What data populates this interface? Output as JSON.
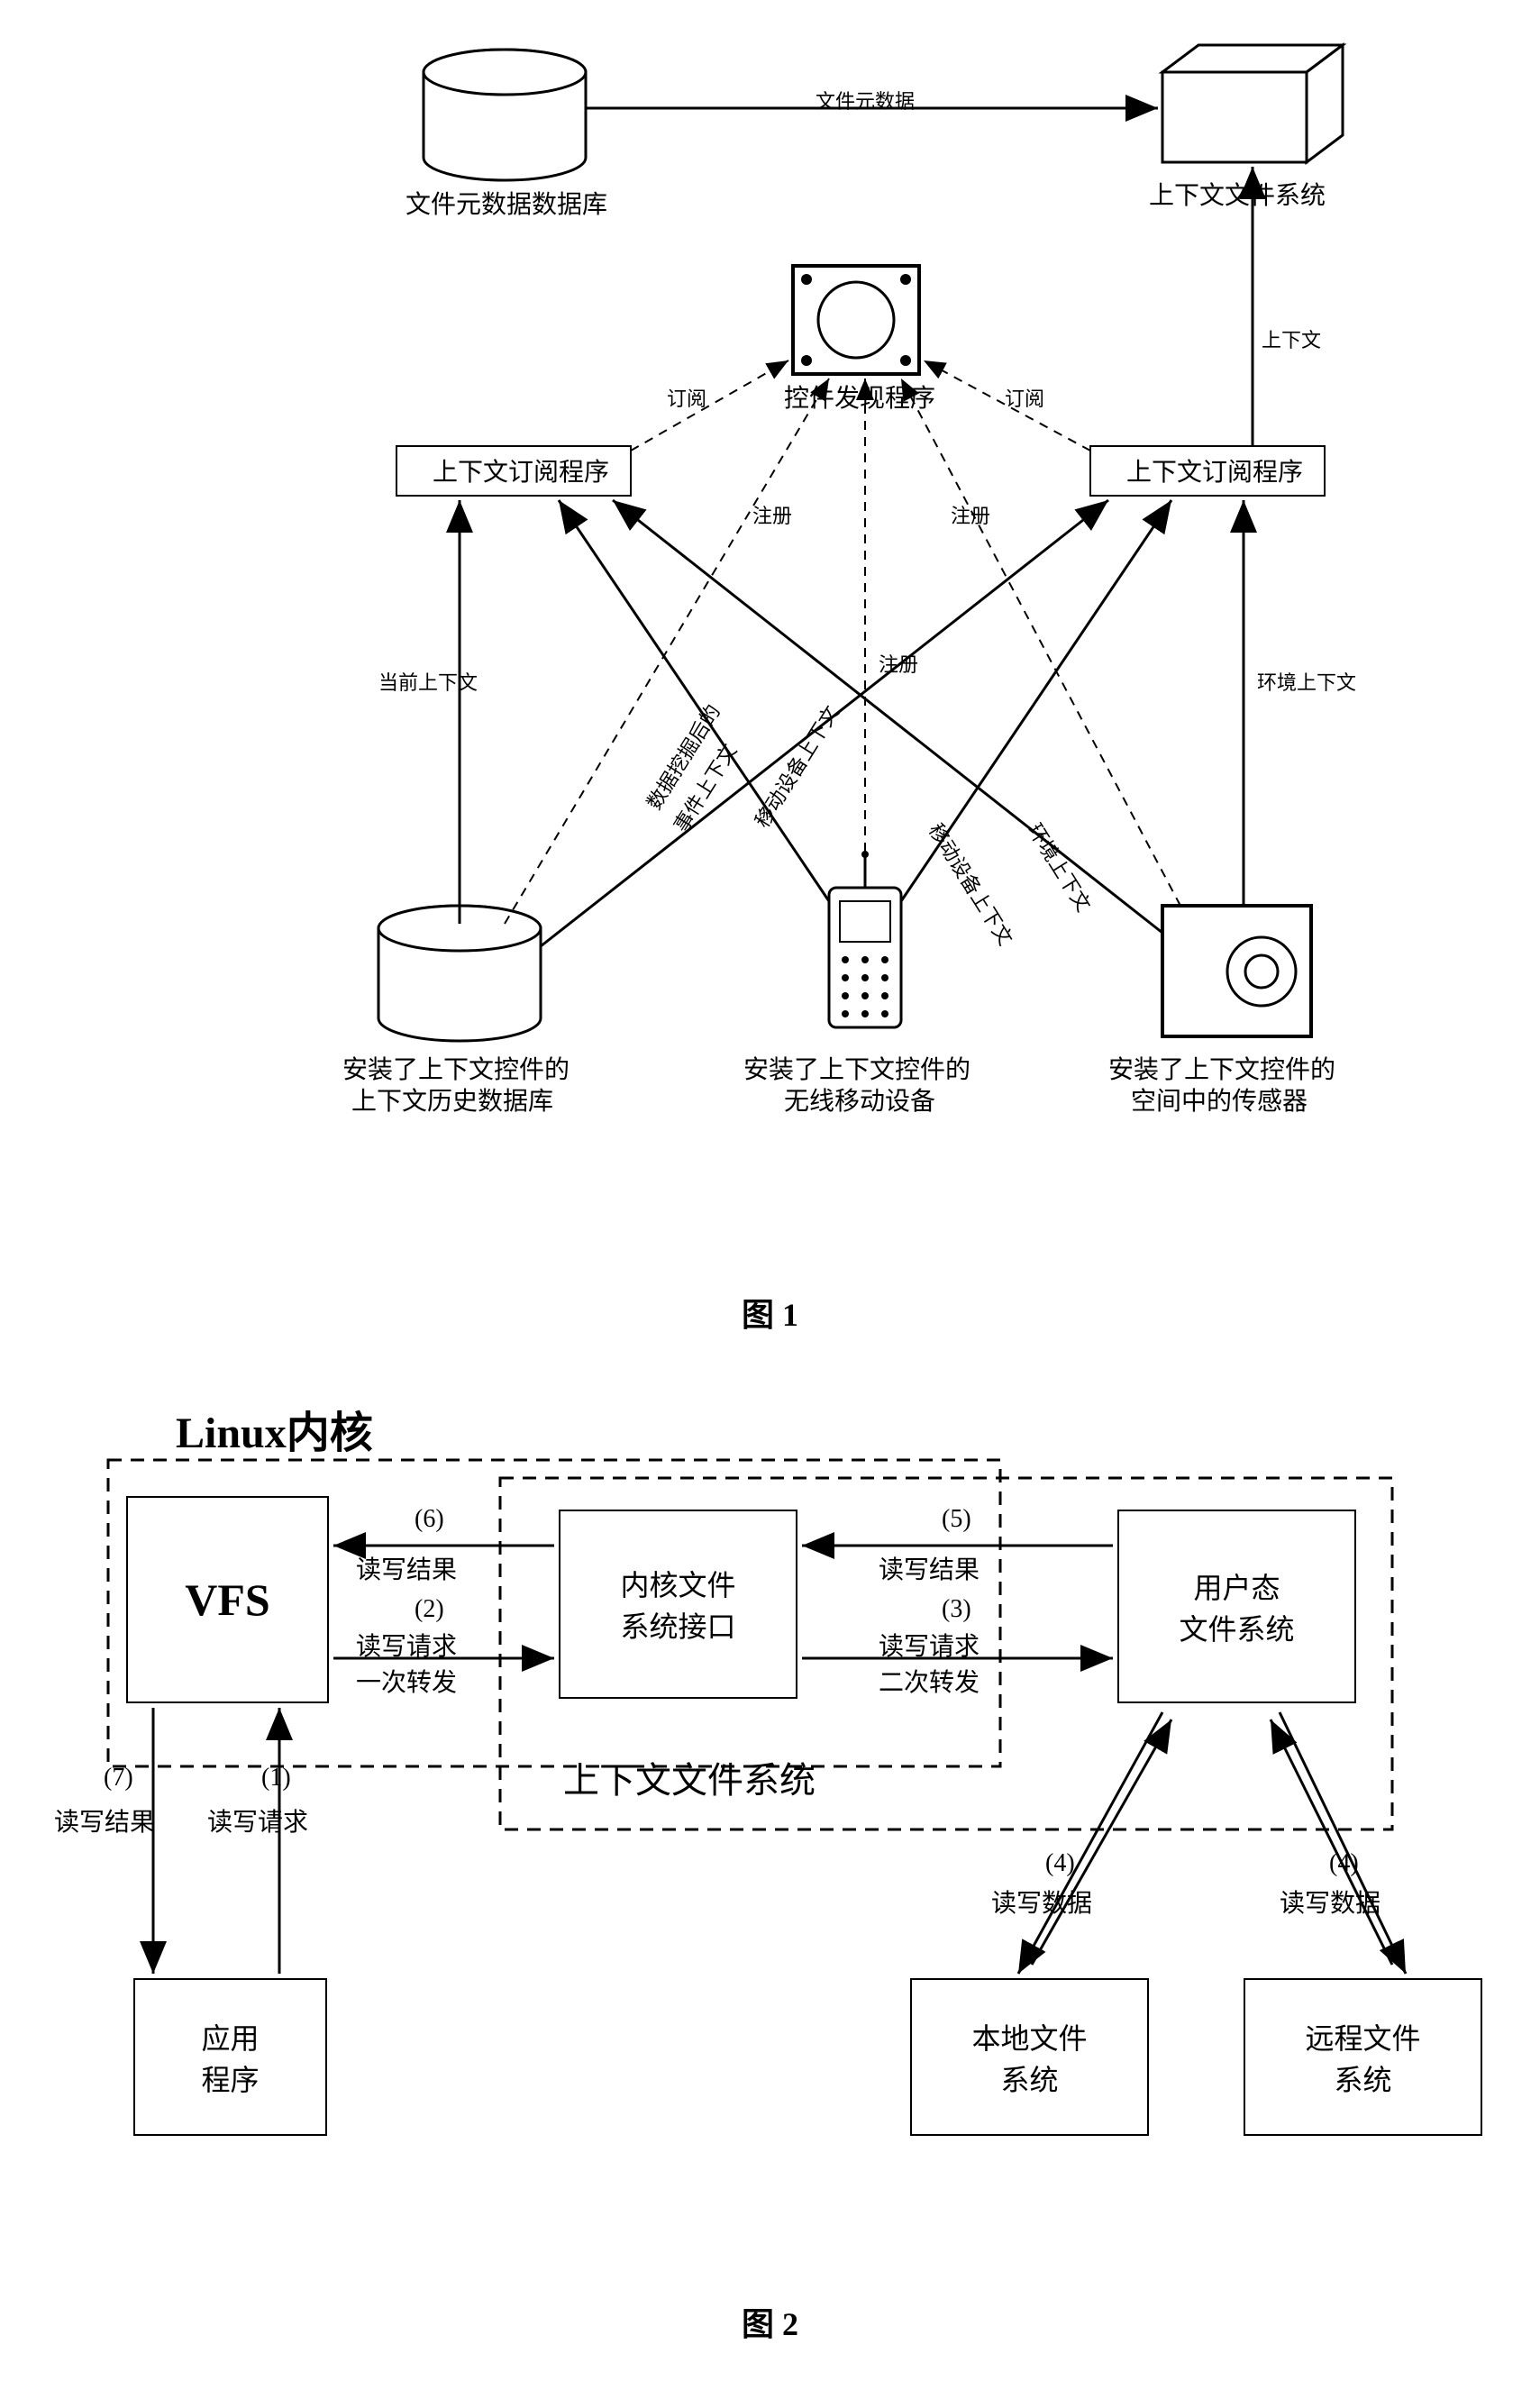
{
  "fig1": {
    "nodes": {
      "metadata_db": "文件元数据数据库",
      "context_fs": "上下文文件系统",
      "discover": "控件发现程序",
      "subscriber_left": "上下文订阅程序",
      "subscriber_right": "上下文订阅程序",
      "history_db_l1": "安装了上下文控件的",
      "history_db_l2": "上下文历史数据库",
      "mobile_l1": "安装了上下文控件的",
      "mobile_l2": "无线移动设备",
      "sensor_l1": "安装了上下文控件的",
      "sensor_l2": "空间中的传感器"
    },
    "edges": {
      "file_metadata": "文件元数据",
      "context": "上下文",
      "subscribe_l": "订阅",
      "subscribe_r": "订阅",
      "register1": "注册",
      "register2": "注册",
      "register3": "注册",
      "current_context": "当前上下文",
      "env_context1": "环境上下文",
      "env_context2": "环境上下文",
      "mobile_ctx1": "移动设备上下文",
      "mobile_ctx2": "移动设备上下文",
      "mined_l1": "数据挖掘后的",
      "mined_l2": "事件上下文"
    },
    "caption": "图 1"
  },
  "fig2": {
    "heading": "Linux内核",
    "nodes": {
      "vfs": "VFS",
      "kernel_if_l1": "内核文件",
      "kernel_if_l2": "系统接口",
      "user_fs_l1": "用户态",
      "user_fs_l2": "文件系统",
      "app_l1": "应用",
      "app_l2": "程序",
      "local_fs_l1": "本地文件",
      "local_fs_l2": "系统",
      "remote_fs_l1": "远程文件",
      "remote_fs_l2": "系统",
      "context_fs_label": "上下文文件系统"
    },
    "edges": {
      "e1_num": "(1)",
      "e1_txt": "读写请求",
      "e2_num": "(2)",
      "e2_txt1": "读写请求",
      "e2_txt2": "一次转发",
      "e3_num": "(3)",
      "e3_txt1": "读写请求",
      "e3_txt2": "二次转发",
      "e4a_num": "(4)",
      "e4a_txt": "读写数据",
      "e4b_num": "(4)",
      "e4b_txt": "读写数据",
      "e5_num": "(5)",
      "e5_txt": "读写结果",
      "e6_num": "(6)",
      "e6_txt": "读写结果",
      "e7_num": "(7)",
      "e7_txt": "读写结果"
    },
    "caption": "图 2"
  }
}
